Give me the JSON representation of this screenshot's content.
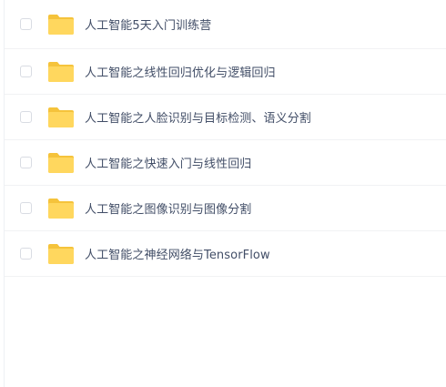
{
  "folder_list": {
    "items": [
      {
        "name": "人工智能5天入门训练营",
        "icon": "folder-icon"
      },
      {
        "name": "人工智能之线性回归优化与逻辑回归",
        "icon": "folder-icon"
      },
      {
        "name": "人工智能之人脸识别与目标检测、语义分割",
        "icon": "folder-icon"
      },
      {
        "name": "人工智能之快速入门与线性回归",
        "icon": "folder-icon"
      },
      {
        "name": "人工智能之图像识别与图像分割",
        "icon": "folder-icon"
      },
      {
        "name": "人工智能之神经网络与TensorFlow",
        "icon": "folder-icon"
      }
    ],
    "colors": {
      "folder_body": "#ffd75e",
      "folder_tab": "#f5c33b",
      "text": "#424e67",
      "row_divider": "#f1f2f4"
    }
  }
}
